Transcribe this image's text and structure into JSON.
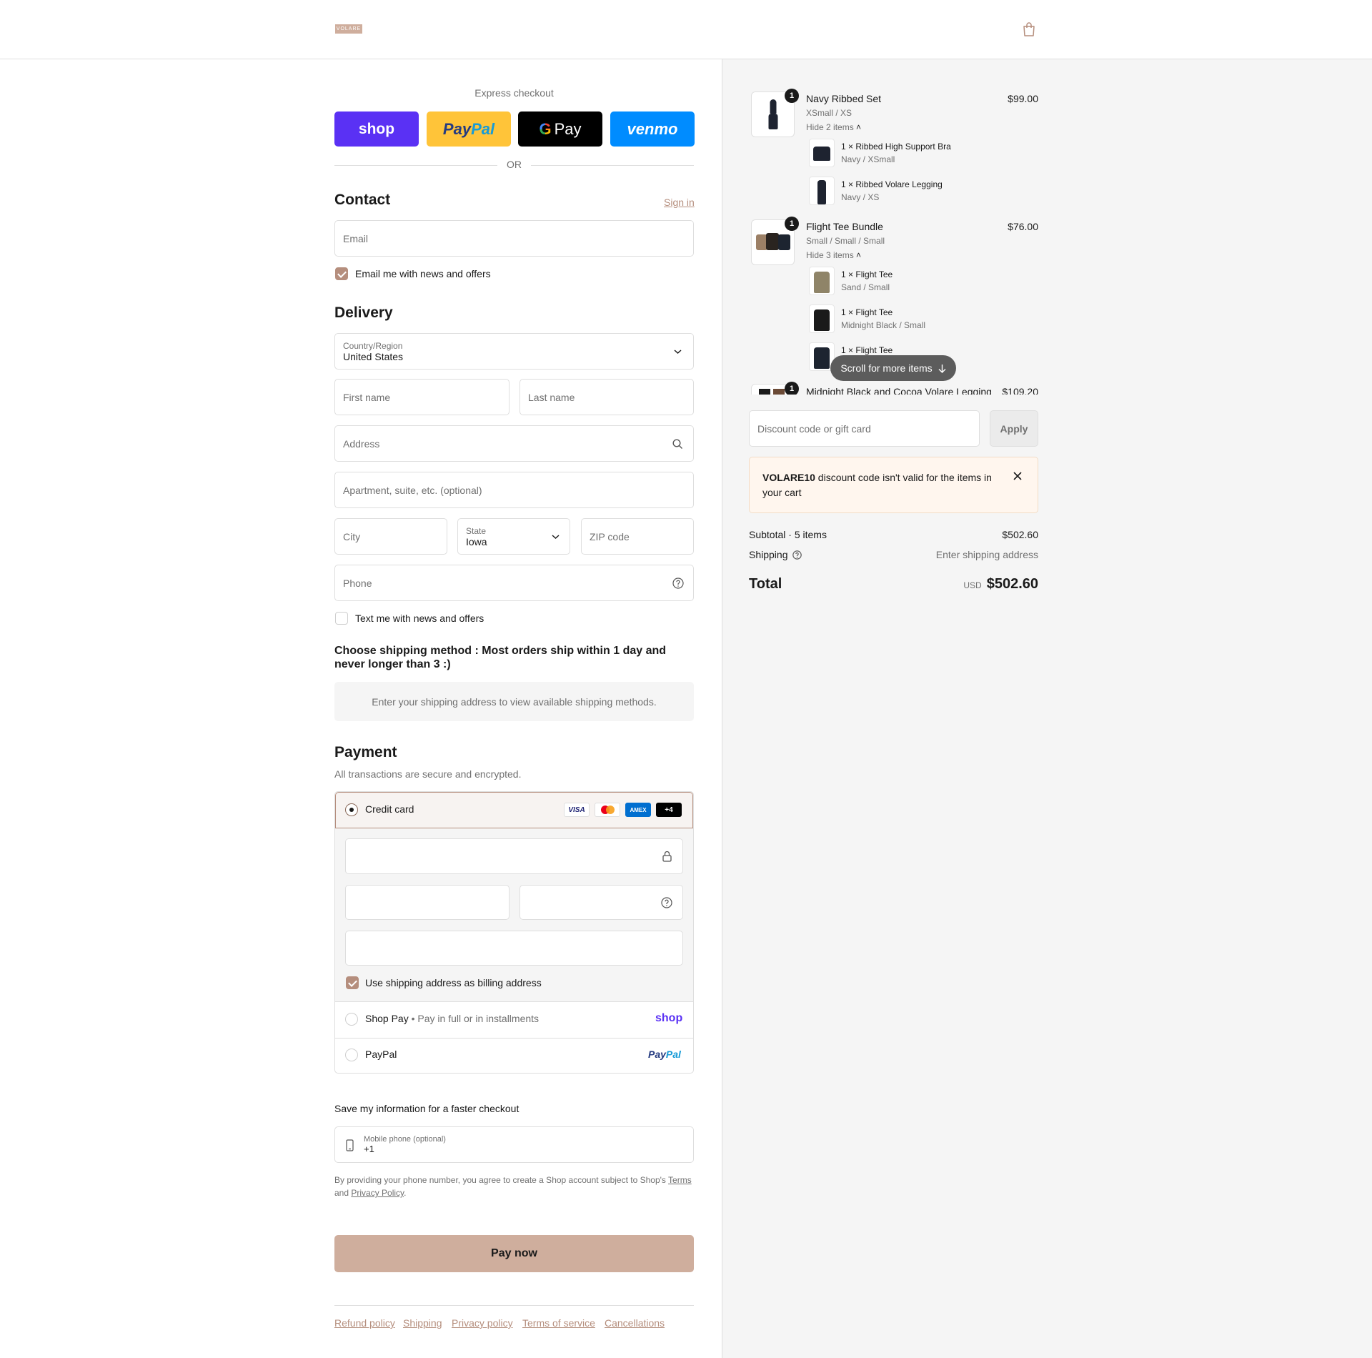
{
  "header": {
    "logo": "VOLARE",
    "cart_icon": "shopping-bag-icon"
  },
  "express": {
    "title": "Express checkout",
    "shop": "shop",
    "paypal_a": "Pay",
    "paypal_b": "Pal",
    "gpay": "Pay",
    "venmo": "venmo",
    "or": "OR"
  },
  "contact": {
    "heading": "Contact",
    "sign_in": "Sign in",
    "email_placeholder": "Email",
    "newsletter": "Email me with news and offers",
    "newsletter_checked": true
  },
  "delivery": {
    "heading": "Delivery",
    "country_label": "Country/Region",
    "country_value": "United States",
    "first_name": "First name",
    "last_name": "Last name",
    "address": "Address",
    "apartment": "Apartment, suite, etc. (optional)",
    "city": "City",
    "state_label": "State",
    "state_value": "Iowa",
    "zip": "ZIP code",
    "phone": "Phone",
    "text_offers": "Text me with news and offers",
    "text_offers_checked": false
  },
  "shipping": {
    "heading": "Choose shipping method : Most orders ship within 1 day and never longer than 3 :)",
    "notice": "Enter your shipping address to view available shipping methods."
  },
  "payment": {
    "heading": "Payment",
    "subtitle": "All transactions are secure and encrypted.",
    "credit_card": "Credit card",
    "card_logos": [
      "VISA",
      "MC",
      "AMEX",
      "+4"
    ],
    "billing_same": "Use shipping address as billing address",
    "shop_pay": "Shop Pay",
    "shop_pay_sub": "Pay in full or in installments",
    "shop_pay_logo": "shop",
    "paypal": "PayPal",
    "paypal_logo_a": "Pay",
    "paypal_logo_b": "Pal"
  },
  "save_info": {
    "heading": "Save my information for a faster checkout",
    "mobile_label": "Mobile phone (optional)",
    "mobile_value": "+1",
    "legal_a": "By providing your phone number, you agree to create a Shop account subject to Shop's ",
    "legal_terms": "Terms",
    "legal_b": "and ",
    "legal_privacy": "Privacy Policy",
    "legal_c": "."
  },
  "pay_button": "Pay now",
  "footer_links": [
    "Refund policy",
    "Shipping",
    "Privacy policy",
    "Terms of service",
    "Cancellations"
  ],
  "order": {
    "items": [
      {
        "name": "Navy Ribbed Set",
        "variant": "XSmall / XS",
        "price": "$99.00",
        "qty": "1",
        "toggle": "Hide 2 items",
        "sub": [
          {
            "qty": "1 ×",
            "name": "Ribbed High Support Bra",
            "variant": "Navy / XSmall"
          },
          {
            "qty": "1 ×",
            "name": "Ribbed Volare Legging",
            "variant": "Navy / XS"
          }
        ]
      },
      {
        "name": "Flight Tee Bundle",
        "variant": "Small / Small / Small",
        "price": "$76.00",
        "qty": "1",
        "toggle": "Hide 3 items",
        "sub": [
          {
            "qty": "1 ×",
            "name": "Flight Tee",
            "variant": "Sand / Small"
          },
          {
            "qty": "1 ×",
            "name": "Flight Tee",
            "variant": "Midnight Black / Small"
          },
          {
            "qty": "1 ×",
            "name": "Flight Tee",
            "variant": ""
          }
        ]
      },
      {
        "name": "Midnight Black and Cocoa Volare Legging",
        "price": "$109.20",
        "qty": "1"
      }
    ],
    "scroll_hint": "Scroll for more items",
    "discount_placeholder": "Discount code or gift card",
    "apply": "Apply",
    "error_code": "VOLARE10",
    "error_text": " discount code isn't valid for the items in your cart",
    "subtotal_label": "Subtotal · 5 items",
    "subtotal_value": "$502.60",
    "shipping_label": "Shipping",
    "shipping_value": "Enter shipping address",
    "total_label": "Total",
    "currency": "USD",
    "total_value": "$502.60"
  },
  "colors": {
    "accent": "#b58e7d",
    "button": "#cfae9d",
    "shop": "#5a31f4",
    "paypal_bg": "#ffc439",
    "venmo": "#008cff"
  }
}
